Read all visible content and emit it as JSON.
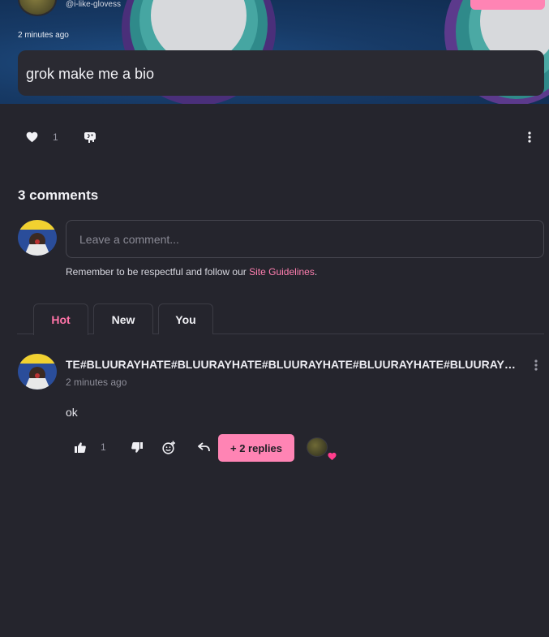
{
  "post": {
    "author_handle": "@i-like-glovess",
    "time": "2 minutes ago",
    "text": "grok make me a bio",
    "like_count": "1"
  },
  "comments": {
    "title": "3 comments",
    "input_placeholder": "Leave a comment...",
    "guidelines_text": "Remember to be respectful and follow our ",
    "guidelines_link": "Site Guidelines",
    "guidelines_end": ".",
    "tabs": [
      {
        "label": "Hot",
        "active": true
      },
      {
        "label": "New",
        "active": false
      },
      {
        "label": "You",
        "active": false
      }
    ],
    "items": [
      {
        "author": "TE#BLUURAYHATE#BLUURAYHATE#BLUURAYHATE#BLUURAYHATE#BLUURAYHATE#BLUURAYHATE",
        "time": "2 minutes ago",
        "body": "ok",
        "like_count": "1",
        "replies_label": "+ 2 replies"
      }
    ]
  },
  "colors": {
    "accent": "#ff84b4",
    "background": "#25252d",
    "heart_badge": "#ff3d8c"
  },
  "icons": [
    "heart-icon",
    "elephant-icon",
    "more-vertical-icon",
    "thumbs-up-icon",
    "thumbs-down-icon",
    "add-reaction-icon",
    "reply-icon"
  ]
}
